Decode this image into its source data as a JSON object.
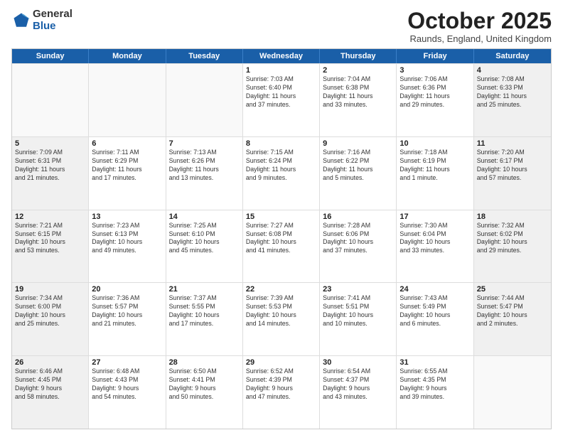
{
  "header": {
    "logo_general": "General",
    "logo_blue": "Blue",
    "title": "October 2025",
    "location": "Raunds, England, United Kingdom"
  },
  "weekdays": [
    "Sunday",
    "Monday",
    "Tuesday",
    "Wednesday",
    "Thursday",
    "Friday",
    "Saturday"
  ],
  "rows": [
    [
      {
        "day": "",
        "text": "",
        "empty": true
      },
      {
        "day": "",
        "text": "",
        "empty": true
      },
      {
        "day": "",
        "text": "",
        "empty": true
      },
      {
        "day": "1",
        "text": "Sunrise: 7:03 AM\nSunset: 6:40 PM\nDaylight: 11 hours\nand 37 minutes."
      },
      {
        "day": "2",
        "text": "Sunrise: 7:04 AM\nSunset: 6:38 PM\nDaylight: 11 hours\nand 33 minutes."
      },
      {
        "day": "3",
        "text": "Sunrise: 7:06 AM\nSunset: 6:36 PM\nDaylight: 11 hours\nand 29 minutes."
      },
      {
        "day": "4",
        "text": "Sunrise: 7:08 AM\nSunset: 6:33 PM\nDaylight: 11 hours\nand 25 minutes.",
        "shaded": true
      }
    ],
    [
      {
        "day": "5",
        "text": "Sunrise: 7:09 AM\nSunset: 6:31 PM\nDaylight: 11 hours\nand 21 minutes.",
        "shaded": true
      },
      {
        "day": "6",
        "text": "Sunrise: 7:11 AM\nSunset: 6:29 PM\nDaylight: 11 hours\nand 17 minutes."
      },
      {
        "day": "7",
        "text": "Sunrise: 7:13 AM\nSunset: 6:26 PM\nDaylight: 11 hours\nand 13 minutes."
      },
      {
        "day": "8",
        "text": "Sunrise: 7:15 AM\nSunset: 6:24 PM\nDaylight: 11 hours\nand 9 minutes."
      },
      {
        "day": "9",
        "text": "Sunrise: 7:16 AM\nSunset: 6:22 PM\nDaylight: 11 hours\nand 5 minutes."
      },
      {
        "day": "10",
        "text": "Sunrise: 7:18 AM\nSunset: 6:19 PM\nDaylight: 11 hours\nand 1 minute."
      },
      {
        "day": "11",
        "text": "Sunrise: 7:20 AM\nSunset: 6:17 PM\nDaylight: 10 hours\nand 57 minutes.",
        "shaded": true
      }
    ],
    [
      {
        "day": "12",
        "text": "Sunrise: 7:21 AM\nSunset: 6:15 PM\nDaylight: 10 hours\nand 53 minutes.",
        "shaded": true
      },
      {
        "day": "13",
        "text": "Sunrise: 7:23 AM\nSunset: 6:13 PM\nDaylight: 10 hours\nand 49 minutes."
      },
      {
        "day": "14",
        "text": "Sunrise: 7:25 AM\nSunset: 6:10 PM\nDaylight: 10 hours\nand 45 minutes."
      },
      {
        "day": "15",
        "text": "Sunrise: 7:27 AM\nSunset: 6:08 PM\nDaylight: 10 hours\nand 41 minutes."
      },
      {
        "day": "16",
        "text": "Sunrise: 7:28 AM\nSunset: 6:06 PM\nDaylight: 10 hours\nand 37 minutes."
      },
      {
        "day": "17",
        "text": "Sunrise: 7:30 AM\nSunset: 6:04 PM\nDaylight: 10 hours\nand 33 minutes."
      },
      {
        "day": "18",
        "text": "Sunrise: 7:32 AM\nSunset: 6:02 PM\nDaylight: 10 hours\nand 29 minutes.",
        "shaded": true
      }
    ],
    [
      {
        "day": "19",
        "text": "Sunrise: 7:34 AM\nSunset: 6:00 PM\nDaylight: 10 hours\nand 25 minutes.",
        "shaded": true
      },
      {
        "day": "20",
        "text": "Sunrise: 7:36 AM\nSunset: 5:57 PM\nDaylight: 10 hours\nand 21 minutes."
      },
      {
        "day": "21",
        "text": "Sunrise: 7:37 AM\nSunset: 5:55 PM\nDaylight: 10 hours\nand 17 minutes."
      },
      {
        "day": "22",
        "text": "Sunrise: 7:39 AM\nSunset: 5:53 PM\nDaylight: 10 hours\nand 14 minutes."
      },
      {
        "day": "23",
        "text": "Sunrise: 7:41 AM\nSunset: 5:51 PM\nDaylight: 10 hours\nand 10 minutes."
      },
      {
        "day": "24",
        "text": "Sunrise: 7:43 AM\nSunset: 5:49 PM\nDaylight: 10 hours\nand 6 minutes."
      },
      {
        "day": "25",
        "text": "Sunrise: 7:44 AM\nSunset: 5:47 PM\nDaylight: 10 hours\nand 2 minutes.",
        "shaded": true
      }
    ],
    [
      {
        "day": "26",
        "text": "Sunrise: 6:46 AM\nSunset: 4:45 PM\nDaylight: 9 hours\nand 58 minutes.",
        "shaded": true
      },
      {
        "day": "27",
        "text": "Sunrise: 6:48 AM\nSunset: 4:43 PM\nDaylight: 9 hours\nand 54 minutes."
      },
      {
        "day": "28",
        "text": "Sunrise: 6:50 AM\nSunset: 4:41 PM\nDaylight: 9 hours\nand 50 minutes."
      },
      {
        "day": "29",
        "text": "Sunrise: 6:52 AM\nSunset: 4:39 PM\nDaylight: 9 hours\nand 47 minutes."
      },
      {
        "day": "30",
        "text": "Sunrise: 6:54 AM\nSunset: 4:37 PM\nDaylight: 9 hours\nand 43 minutes."
      },
      {
        "day": "31",
        "text": "Sunrise: 6:55 AM\nSunset: 4:35 PM\nDaylight: 9 hours\nand 39 minutes."
      },
      {
        "day": "",
        "text": "",
        "empty": true
      }
    ]
  ]
}
